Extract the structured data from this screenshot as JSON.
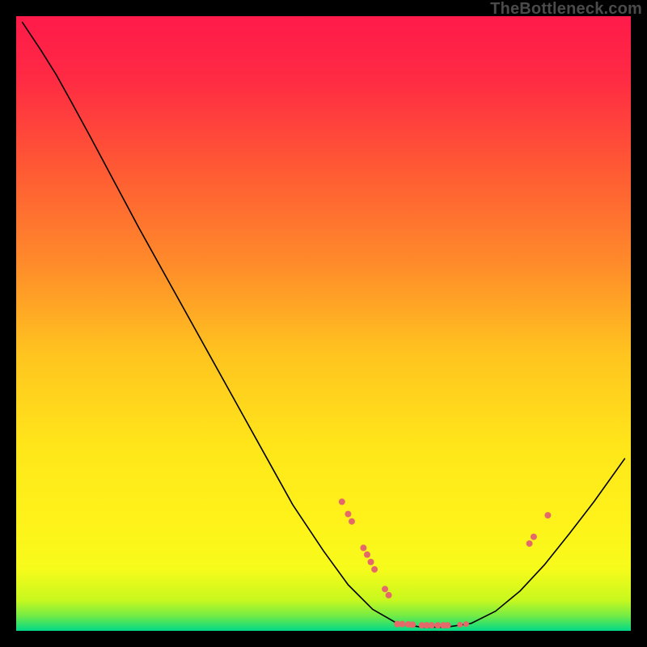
{
  "watermark": "TheBottleneck.com",
  "chart_data": {
    "type": "line",
    "title": "",
    "xlabel": "",
    "ylabel": "",
    "xlim": [
      0,
      100
    ],
    "ylim": [
      0,
      100
    ],
    "grid": false,
    "legend": false,
    "background_gradient": {
      "stops": [
        {
          "offset": 0.0,
          "color": "#ff1a4a"
        },
        {
          "offset": 0.1,
          "color": "#ff2a44"
        },
        {
          "offset": 0.25,
          "color": "#ff5a34"
        },
        {
          "offset": 0.4,
          "color": "#ff8a2a"
        },
        {
          "offset": 0.55,
          "color": "#ffc41f"
        },
        {
          "offset": 0.7,
          "color": "#ffe61a"
        },
        {
          "offset": 0.82,
          "color": "#fff21a"
        },
        {
          "offset": 0.9,
          "color": "#f6fb1a"
        },
        {
          "offset": 0.95,
          "color": "#c8f81e"
        },
        {
          "offset": 0.975,
          "color": "#76ec44"
        },
        {
          "offset": 1.0,
          "color": "#00d887"
        }
      ]
    },
    "series": [
      {
        "name": "curve",
        "stroke": "#000000",
        "strokeWidth": 1.6,
        "points": [
          {
            "x": 1.0,
            "y": 99.0
          },
          {
            "x": 4.0,
            "y": 94.5
          },
          {
            "x": 6.5,
            "y": 90.5
          },
          {
            "x": 9.0,
            "y": 86.0
          },
          {
            "x": 12.0,
            "y": 80.5
          },
          {
            "x": 16.0,
            "y": 73.0
          },
          {
            "x": 20.0,
            "y": 65.5
          },
          {
            "x": 25.0,
            "y": 56.5
          },
          {
            "x": 30.0,
            "y": 47.5
          },
          {
            "x": 35.0,
            "y": 38.5
          },
          {
            "x": 40.0,
            "y": 29.5
          },
          {
            "x": 45.0,
            "y": 20.5
          },
          {
            "x": 50.0,
            "y": 13.0
          },
          {
            "x": 54.0,
            "y": 7.5
          },
          {
            "x": 58.0,
            "y": 3.5
          },
          {
            "x": 62.0,
            "y": 1.2
          },
          {
            "x": 66.0,
            "y": 0.6
          },
          {
            "x": 70.0,
            "y": 0.6
          },
          {
            "x": 74.0,
            "y": 1.2
          },
          {
            "x": 78.0,
            "y": 3.2
          },
          {
            "x": 82.0,
            "y": 6.5
          },
          {
            "x": 86.0,
            "y": 10.8
          },
          {
            "x": 90.0,
            "y": 15.8
          },
          {
            "x": 94.0,
            "y": 21.0
          },
          {
            "x": 99.0,
            "y": 28.0
          }
        ]
      }
    ],
    "markers": {
      "name": "data-points",
      "fill": "#e46a6a",
      "stroke": "none",
      "radius_default": 4.0,
      "points": [
        {
          "x": 53.0,
          "y": 21.0,
          "r": 4.0
        },
        {
          "x": 54.0,
          "y": 19.0,
          "r": 4.0
        },
        {
          "x": 54.6,
          "y": 17.8,
          "r": 4.0
        },
        {
          "x": 56.5,
          "y": 13.5,
          "r": 4.0
        },
        {
          "x": 57.1,
          "y": 12.4,
          "r": 4.0
        },
        {
          "x": 57.7,
          "y": 11.2,
          "r": 4.0
        },
        {
          "x": 58.3,
          "y": 10.0,
          "r": 4.0
        },
        {
          "x": 60.0,
          "y": 6.8,
          "r": 4.0
        },
        {
          "x": 60.6,
          "y": 5.8,
          "r": 4.0
        },
        {
          "x": 62.0,
          "y": 1.1,
          "r": 4.0
        },
        {
          "x": 62.8,
          "y": 1.1,
          "r": 4.0
        },
        {
          "x": 63.8,
          "y": 1.05,
          "r": 4.0
        },
        {
          "x": 64.5,
          "y": 1.0,
          "r": 4.0
        },
        {
          "x": 66.0,
          "y": 0.9,
          "r": 4.0
        },
        {
          "x": 66.8,
          "y": 0.9,
          "r": 4.0
        },
        {
          "x": 67.6,
          "y": 0.9,
          "r": 4.0
        },
        {
          "x": 68.6,
          "y": 0.9,
          "r": 4.0
        },
        {
          "x": 69.5,
          "y": 0.9,
          "r": 4.0
        },
        {
          "x": 70.2,
          "y": 0.9,
          "r": 4.0
        },
        {
          "x": 72.2,
          "y": 1.0,
          "r": 3.5
        },
        {
          "x": 73.2,
          "y": 1.1,
          "r": 3.5
        },
        {
          "x": 83.5,
          "y": 14.2,
          "r": 4.0
        },
        {
          "x": 84.2,
          "y": 15.3,
          "r": 4.0
        },
        {
          "x": 86.5,
          "y": 18.8,
          "r": 4.0
        }
      ]
    }
  }
}
